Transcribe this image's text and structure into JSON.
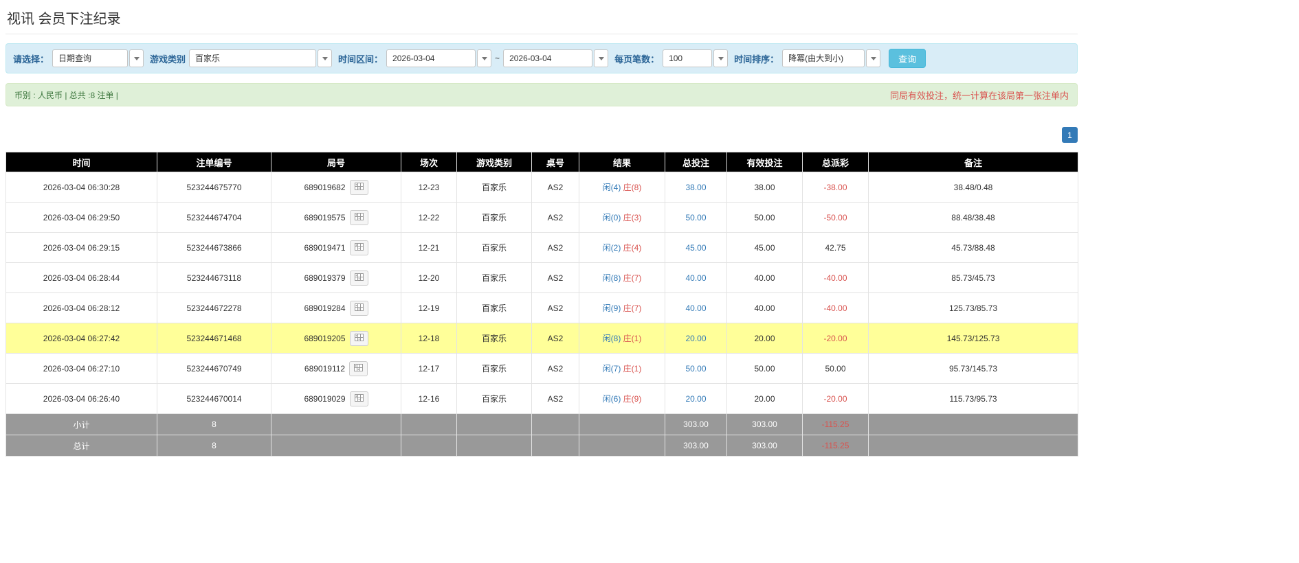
{
  "colors": {
    "accent_blue": "#337ab7",
    "filter_bg": "#d9edf7",
    "filter_border": "#bce8f1",
    "filter_label": "#2a6496",
    "info_bg": "#dff0d8",
    "info_border": "#d6e9c6",
    "info_text": "#3c763d",
    "note_red": "#d9534f",
    "player_blue": "#337ab7",
    "banker_red": "#d9534f",
    "negative_red": "#d9534f",
    "highlight_yellow": "#ffff99",
    "header_bg": "#000000",
    "footer_bg": "#999999",
    "search_btn_bg": "#5bc0de"
  },
  "page": {
    "title": "视讯 会员下注纪录"
  },
  "filters": {
    "select_label": "请选择：",
    "select_value": "日期查询",
    "game_type_label": "游戏类别",
    "game_type_value": "百家乐",
    "time_range_label": "时间区间：",
    "time_from": "2026-03-04",
    "time_separator": "~",
    "time_to": "2026-03-04",
    "page_size_label": "每页笔数：",
    "page_size_value": "100",
    "sort_label": "时间排序：",
    "sort_value": "降冪(由大到小)",
    "search_button_label": "查询"
  },
  "summary": {
    "left_text": "币别 : 人民币 | 总共 :8 注单 |",
    "note": "同局有效投注，统一计算在该局第一张注单内"
  },
  "pagination": {
    "page": "1"
  },
  "table": {
    "headers": [
      "时间",
      "注单编号",
      "局号",
      "场次",
      "游戏类别",
      "桌号",
      "结果",
      "总投注",
      "有效投注",
      "总派彩",
      "备注"
    ],
    "rows": [
      {
        "time": "2026-03-04 06:30:28",
        "bet_id": "523244675770",
        "round_id": "689019682",
        "session": "12-23",
        "game_type": "百家乐",
        "table_no": "AS2",
        "result_player": "闲(4)",
        "result_banker": "庄(8)",
        "total_bet": "38.00",
        "valid_bet": "38.00",
        "payout": "-38.00",
        "remark": "38.48/0.48",
        "highlighted": false
      },
      {
        "time": "2026-03-04 06:29:50",
        "bet_id": "523244674704",
        "round_id": "689019575",
        "session": "12-22",
        "game_type": "百家乐",
        "table_no": "AS2",
        "result_player": "闲(0)",
        "result_banker": "庄(3)",
        "total_bet": "50.00",
        "valid_bet": "50.00",
        "payout": "-50.00",
        "remark": "88.48/38.48",
        "highlighted": false
      },
      {
        "time": "2026-03-04 06:29:15",
        "bet_id": "523244673866",
        "round_id": "689019471",
        "session": "12-21",
        "game_type": "百家乐",
        "table_no": "AS2",
        "result_player": "闲(2)",
        "result_banker": "庄(4)",
        "total_bet": "45.00",
        "valid_bet": "45.00",
        "payout": "42.75",
        "remark": "45.73/88.48",
        "highlighted": false
      },
      {
        "time": "2026-03-04 06:28:44",
        "bet_id": "523244673118",
        "round_id": "689019379",
        "session": "12-20",
        "game_type": "百家乐",
        "table_no": "AS2",
        "result_player": "闲(8)",
        "result_banker": "庄(7)",
        "total_bet": "40.00",
        "valid_bet": "40.00",
        "payout": "-40.00",
        "remark": "85.73/45.73",
        "highlighted": false
      },
      {
        "time": "2026-03-04 06:28:12",
        "bet_id": "523244672278",
        "round_id": "689019284",
        "session": "12-19",
        "game_type": "百家乐",
        "table_no": "AS2",
        "result_player": "闲(9)",
        "result_banker": "庄(7)",
        "total_bet": "40.00",
        "valid_bet": "40.00",
        "payout": "-40.00",
        "remark": "125.73/85.73",
        "highlighted": false
      },
      {
        "time": "2026-03-04 06:27:42",
        "bet_id": "523244671468",
        "round_id": "689019205",
        "session": "12-18",
        "game_type": "百家乐",
        "table_no": "AS2",
        "result_player": "闲(8)",
        "result_banker": "庄(1)",
        "total_bet": "20.00",
        "valid_bet": "20.00",
        "payout": "-20.00",
        "remark": "145.73/125.73",
        "highlighted": true
      },
      {
        "time": "2026-03-04 06:27:10",
        "bet_id": "523244670749",
        "round_id": "689019112",
        "session": "12-17",
        "game_type": "百家乐",
        "table_no": "AS2",
        "result_player": "闲(7)",
        "result_banker": "庄(1)",
        "total_bet": "50.00",
        "valid_bet": "50.00",
        "payout": "50.00",
        "remark": "95.73/145.73",
        "highlighted": false
      },
      {
        "time": "2026-03-04 06:26:40",
        "bet_id": "523244670014",
        "round_id": "689019029",
        "session": "12-16",
        "game_type": "百家乐",
        "table_no": "AS2",
        "result_player": "闲(6)",
        "result_banker": "庄(9)",
        "total_bet": "20.00",
        "valid_bet": "20.00",
        "payout": "-20.00",
        "remark": "115.73/95.73",
        "highlighted": false
      }
    ],
    "subtotal": {
      "label": "小计",
      "count": "8",
      "total_bet": "303.00",
      "valid_bet": "303.00",
      "payout": "-115.25"
    },
    "total": {
      "label": "总计",
      "count": "8",
      "total_bet": "303.00",
      "valid_bet": "303.00",
      "payout": "-115.25"
    }
  }
}
